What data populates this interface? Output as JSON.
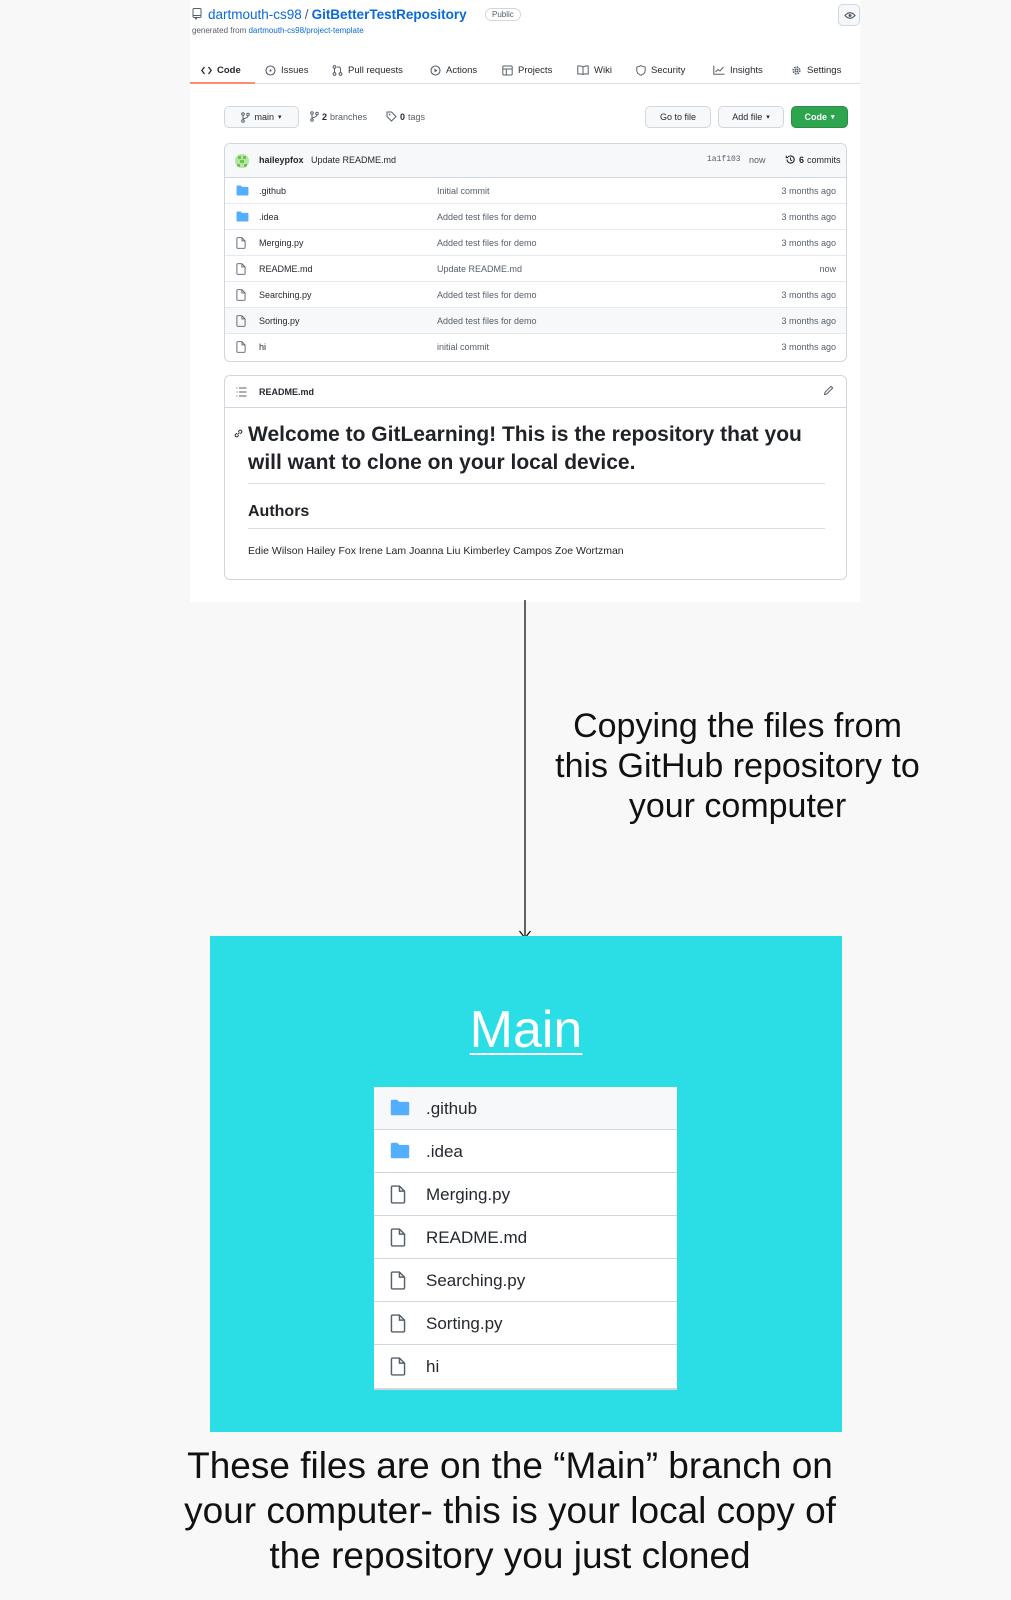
{
  "github": {
    "owner": "dartmouth-cs98",
    "separator": "/",
    "repo": "GitBetterTestRepository",
    "visibility": "Public",
    "generated_prefix": "generated from ",
    "generated_from": "dartmouth-cs98/project-template",
    "tabs": [
      {
        "label": "Code",
        "icon": "code-icon"
      },
      {
        "label": "Issues",
        "icon": "issue-icon"
      },
      {
        "label": "Pull requests",
        "icon": "pull-request-icon"
      },
      {
        "label": "Actions",
        "icon": "play-icon"
      },
      {
        "label": "Projects",
        "icon": "table-icon"
      },
      {
        "label": "Wiki",
        "icon": "book-icon"
      },
      {
        "label": "Security",
        "icon": "shield-icon"
      },
      {
        "label": "Insights",
        "icon": "graph-icon"
      },
      {
        "label": "Settings",
        "icon": "gear-icon"
      }
    ],
    "branch": "main",
    "branches_count": "2",
    "branches_label": "branches",
    "tags_count": "0",
    "tags_label": "tags",
    "go_to_file": "Go to file",
    "add_file": "Add file",
    "code_button": "Code",
    "latest_commit": {
      "user": "haileypfox",
      "message": "Update README.md",
      "sha": "1a1f103",
      "time": "now",
      "count": "6",
      "count_label": "commits"
    },
    "files": [
      {
        "name": ".github",
        "type": "folder",
        "message": "Initial commit",
        "age": "3 months ago"
      },
      {
        "name": ".idea",
        "type": "folder",
        "message": "Added test files for demo",
        "age": "3 months ago"
      },
      {
        "name": "Merging.py",
        "type": "file",
        "message": "Added test files for demo",
        "age": "3 months ago"
      },
      {
        "name": "README.md",
        "type": "file",
        "message": "Update README.md",
        "age": "now"
      },
      {
        "name": "Searching.py",
        "type": "file",
        "message": "Added test files for demo",
        "age": "3 months ago"
      },
      {
        "name": "Sorting.py",
        "type": "file",
        "message": "Added test files for demo",
        "age": "3 months ago"
      },
      {
        "name": "hi",
        "type": "file",
        "message": "initial commit",
        "age": "3 months ago"
      }
    ],
    "readme": {
      "filename": "README.md",
      "heading": "Welcome to GitLearning! This is the repository that you will want to clone on your local device.",
      "subheading": "Authors",
      "authors": "Edie Wilson Hailey Fox Irene Lam Joanna Liu Kimberley Campos Zoe Wortzman"
    }
  },
  "arrow_caption": "Copying the files from this GitHub repository to your computer",
  "local": {
    "title": "Main",
    "files": [
      {
        "name": ".github",
        "type": "folder"
      },
      {
        "name": ".idea",
        "type": "folder"
      },
      {
        "name": "Merging.py",
        "type": "file"
      },
      {
        "name": "README.md",
        "type": "file"
      },
      {
        "name": "Searching.py",
        "type": "file"
      },
      {
        "name": "Sorting.py",
        "type": "file"
      },
      {
        "name": "hi",
        "type": "file"
      }
    ]
  },
  "bottom_caption": "These files are on the “Main” branch on your computer- this is your local copy of the repository you just cloned",
  "colors": {
    "accent_blue": "#0969da",
    "folder_blue": "#54aeff",
    "code_green": "#2da44e",
    "tab_underline": "#fd8c73",
    "local_panel": "#2bdde4"
  }
}
